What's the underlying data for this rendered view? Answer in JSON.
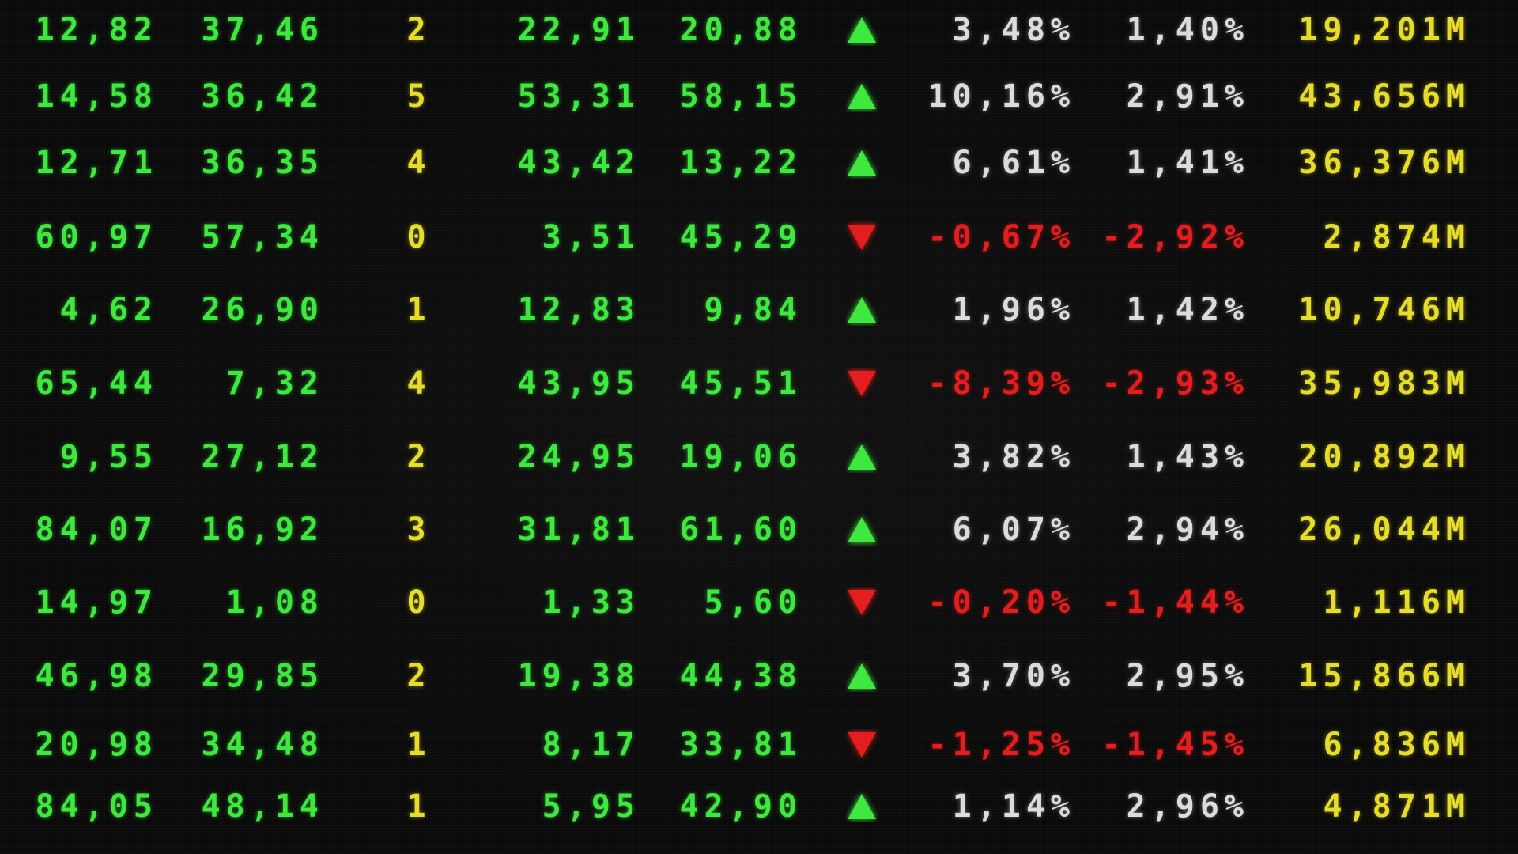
{
  "colors": {
    "background": "#0a0a0a",
    "green": "#3ee83e",
    "yellow": "#e6dc2a",
    "white": "#dcdcdc",
    "red": "#e41e1e"
  },
  "rows": [
    {
      "c1": "12,82",
      "c2": "37,46",
      "c3": "2",
      "c4": "22,91",
      "c5": "20,88",
      "dir": "up",
      "pct1": "3,48%",
      "pct2": "1,40%",
      "vol": "19,201M"
    },
    {
      "c1": "14,58",
      "c2": "36,42",
      "c3": "5",
      "c4": "53,31",
      "c5": "58,15",
      "dir": "up",
      "pct1": "10,16%",
      "pct2": "2,91%",
      "vol": "43,656M"
    },
    {
      "c1": "12,71",
      "c2": "36,35",
      "c3": "4",
      "c4": "43,42",
      "c5": "13,22",
      "dir": "up",
      "pct1": "6,61%",
      "pct2": "1,41%",
      "vol": "36,376M"
    },
    {
      "c1": "60,97",
      "c2": "57,34",
      "c3": "0",
      "c4": "3,51",
      "c5": "45,29",
      "dir": "down",
      "pct1": "-0,67%",
      "pct2": "-2,92%",
      "vol": "2,874M"
    },
    {
      "c1": "4,62",
      "c2": "26,90",
      "c3": "1",
      "c4": "12,83",
      "c5": "9,84",
      "dir": "up",
      "pct1": "1,96%",
      "pct2": "1,42%",
      "vol": "10,746M"
    },
    {
      "c1": "65,44",
      "c2": "7,32",
      "c3": "4",
      "c4": "43,95",
      "c5": "45,51",
      "dir": "down",
      "pct1": "-8,39%",
      "pct2": "-2,93%",
      "vol": "35,983M"
    },
    {
      "c1": "9,55",
      "c2": "27,12",
      "c3": "2",
      "c4": "24,95",
      "c5": "19,06",
      "dir": "up",
      "pct1": "3,82%",
      "pct2": "1,43%",
      "vol": "20,892M"
    },
    {
      "c1": "84,07",
      "c2": "16,92",
      "c3": "3",
      "c4": "31,81",
      "c5": "61,60",
      "dir": "up",
      "pct1": "6,07%",
      "pct2": "2,94%",
      "vol": "26,044M"
    },
    {
      "c1": "14,97",
      "c2": "1,08",
      "c3": "0",
      "c4": "1,33",
      "c5": "5,60",
      "dir": "down",
      "pct1": "-0,20%",
      "pct2": "-1,44%",
      "vol": "1,116M"
    },
    {
      "c1": "46,98",
      "c2": "29,85",
      "c3": "2",
      "c4": "19,38",
      "c5": "44,38",
      "dir": "up",
      "pct1": "3,70%",
      "pct2": "2,95%",
      "vol": "15,866M"
    },
    {
      "c1": "20,98",
      "c2": "34,48",
      "c3": "1",
      "c4": "8,17",
      "c5": "33,81",
      "dir": "down",
      "pct1": "-1,25%",
      "pct2": "-1,45%",
      "vol": "6,836M"
    },
    {
      "c1": "84,05",
      "c2": "48,14",
      "c3": "1",
      "c4": "5,95",
      "c5": "42,90",
      "dir": "up",
      "pct1": "1,14%",
      "pct2": "2,96%",
      "vol": "4,871M"
    }
  ]
}
